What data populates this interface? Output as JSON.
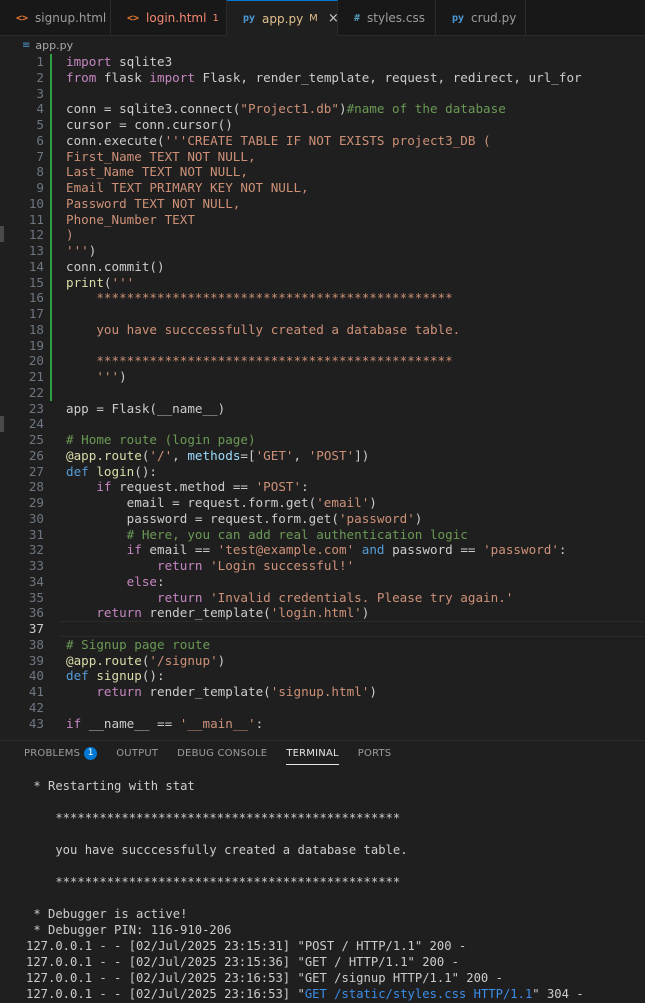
{
  "tabs": [
    {
      "name": "signup.html",
      "icon": "<>",
      "icon_color": "#e37933",
      "badge": "",
      "active": false
    },
    {
      "name": "login.html",
      "icon": "<>",
      "icon_color": "#e37933",
      "badge": "1",
      "active": false
    },
    {
      "name": "app.py",
      "icon": "py",
      "icon_color": "#4d9bd6",
      "badge": "M",
      "active": true
    },
    {
      "name": "styles.css",
      "icon": "#",
      "icon_color": "#519aba",
      "badge": "",
      "active": false
    },
    {
      "name": "crud.py",
      "icon": "py",
      "icon_color": "#4d9bd6",
      "badge": "",
      "active": false
    }
  ],
  "breadcrumb": {
    "file": "app.py"
  },
  "editor": {
    "current_line": 37,
    "lines": [
      {
        "n": "1",
        "html": "<span class='kw'>import</span> sqlite3"
      },
      {
        "n": "2",
        "html": "<span class='kw'>from</span> flask <span class='kw'>import</span> Flask, render_template, request, redirect, url_for"
      },
      {
        "n": "3",
        "html": ""
      },
      {
        "n": "4",
        "html": "conn = sqlite3.connect(<span class='str'>\"Project1.db\"</span>)<span class='cm'>#name of the database</span>"
      },
      {
        "n": "5",
        "html": "cursor = conn.cursor()"
      },
      {
        "n": "6",
        "html": "conn.execute(<span class='str'>'''CREATE TABLE IF NOT EXISTS project3_DB (</span>"
      },
      {
        "n": "7",
        "html": "<span class='str'>First_Name TEXT NOT NULL,</span>"
      },
      {
        "n": "8",
        "html": "<span class='str'>Last_Name TEXT NOT NULL,</span>"
      },
      {
        "n": "9",
        "html": "<span class='str'>Email TEXT PRIMARY KEY NOT NULL,</span>"
      },
      {
        "n": "10",
        "html": "<span class='str'>Password TEXT NOT NULL,</span>"
      },
      {
        "n": "11",
        "html": "<span class='str'>Phone_Number TEXT</span>"
      },
      {
        "n": "12",
        "html": "<span class='str'>)</span>"
      },
      {
        "n": "13",
        "html": "<span class='str'>'''</span>)"
      },
      {
        "n": "14",
        "html": "conn.commit()"
      },
      {
        "n": "15",
        "html": "<span class='fn'>print</span>(<span class='str'>'''</span>"
      },
      {
        "n": "16",
        "html": "<span class='str'>    ***********************************************</span>"
      },
      {
        "n": "17",
        "html": ""
      },
      {
        "n": "18",
        "html": "<span class='str'>    you have succcessfully created a database table.</span>"
      },
      {
        "n": "19",
        "html": ""
      },
      {
        "n": "20",
        "html": "<span class='str'>    ***********************************************</span>"
      },
      {
        "n": "21",
        "html": "<span class='str'>    '''</span>)"
      },
      {
        "n": "22",
        "html": ""
      },
      {
        "n": "23",
        "html": "app = Flask(__name__)"
      },
      {
        "n": "24",
        "html": ""
      },
      {
        "n": "25",
        "html": "<span class='cm'># Home route (login page)</span>"
      },
      {
        "n": "26",
        "html": "<span class='fn'>@app.route</span>(<span class='str'>'/'</span>, <span class='var'>methods</span>=[<span class='str'>'GET'</span>, <span class='str'>'POST'</span>])"
      },
      {
        "n": "27",
        "html": "<span class='kw2'>def</span> <span class='fn'>login</span>():"
      },
      {
        "n": "28",
        "html": "    <span class='kw'>if</span> request.method == <span class='str'>'POST'</span>:"
      },
      {
        "n": "29",
        "html": "        email = request.form.get(<span class='str'>'email'</span>)"
      },
      {
        "n": "30",
        "html": "        password = request.form.get(<span class='str'>'password'</span>)"
      },
      {
        "n": "31",
        "html": "        <span class='cm'># Here, you can add real authentication logic</span>"
      },
      {
        "n": "32",
        "html": "        <span class='kw'>if</span> email == <span class='str'>'test@example.com'</span> <span class='kw2'>and</span> password == <span class='str'>'password'</span>:"
      },
      {
        "n": "33",
        "html": "            <span class='kw'>return</span> <span class='str'>'Login successful!'</span>"
      },
      {
        "n": "34",
        "html": "        <span class='kw'>else</span>:"
      },
      {
        "n": "35",
        "html": "            <span class='kw'>return</span> <span class='str'>'Invalid credentials. Please try again.'</span>"
      },
      {
        "n": "36",
        "html": "    <span class='kw'>return</span> render_template(<span class='str'>'login.html'</span>)"
      },
      {
        "n": "37",
        "html": ""
      },
      {
        "n": "38",
        "html": "<span class='cm'># Signup page route</span>"
      },
      {
        "n": "39",
        "html": "<span class='fn'>@app.route</span>(<span class='str'>'/signup'</span>)"
      },
      {
        "n": "40",
        "html": "<span class='kw2'>def</span> <span class='fn'>signup</span>():"
      },
      {
        "n": "41",
        "html": "    <span class='kw'>return</span> render_template(<span class='str'>'signup.html'</span>)"
      },
      {
        "n": "42",
        "html": ""
      },
      {
        "n": "43",
        "html": "<span class='kw'>if</span> __name__ == <span class='str'>'__main__'</span>:"
      }
    ]
  },
  "panel_tabs": [
    {
      "label": "PROBLEMS",
      "badge": "1",
      "active": false
    },
    {
      "label": "OUTPUT",
      "badge": "",
      "active": false
    },
    {
      "label": "DEBUG CONSOLE",
      "badge": "",
      "active": false
    },
    {
      "label": "TERMINAL",
      "badge": "",
      "active": true
    },
    {
      "label": "PORTS",
      "badge": "",
      "active": false
    }
  ],
  "terminal": {
    "lines": [
      {
        "text": " * Restarting with stat"
      },
      {
        "text": ""
      },
      {
        "text": "    ***********************************************"
      },
      {
        "text": ""
      },
      {
        "text": "    you have succcessfully created a database table."
      },
      {
        "text": ""
      },
      {
        "text": "    ***********************************************"
      },
      {
        "text": ""
      },
      {
        "text": " * Debugger is active!"
      },
      {
        "text": " * Debugger PIN: 116-910-206"
      },
      {
        "text": "127.0.0.1 - - [02/Jul/2025 23:15:31] \"POST / HTTP/1.1\" 200 -"
      },
      {
        "text": "127.0.0.1 - - [02/Jul/2025 23:15:36] \"GET / HTTP/1.1\" 200 -"
      },
      {
        "text": "127.0.0.1 - - [02/Jul/2025 23:16:53] \"GET /signup HTTP/1.1\" 200 -"
      },
      {
        "pre": "127.0.0.1 - - [02/Jul/2025 23:16:53] \"",
        "blue": "GET /static/styles.css HTTP/1.1",
        "post": "\" 304 -"
      }
    ]
  }
}
